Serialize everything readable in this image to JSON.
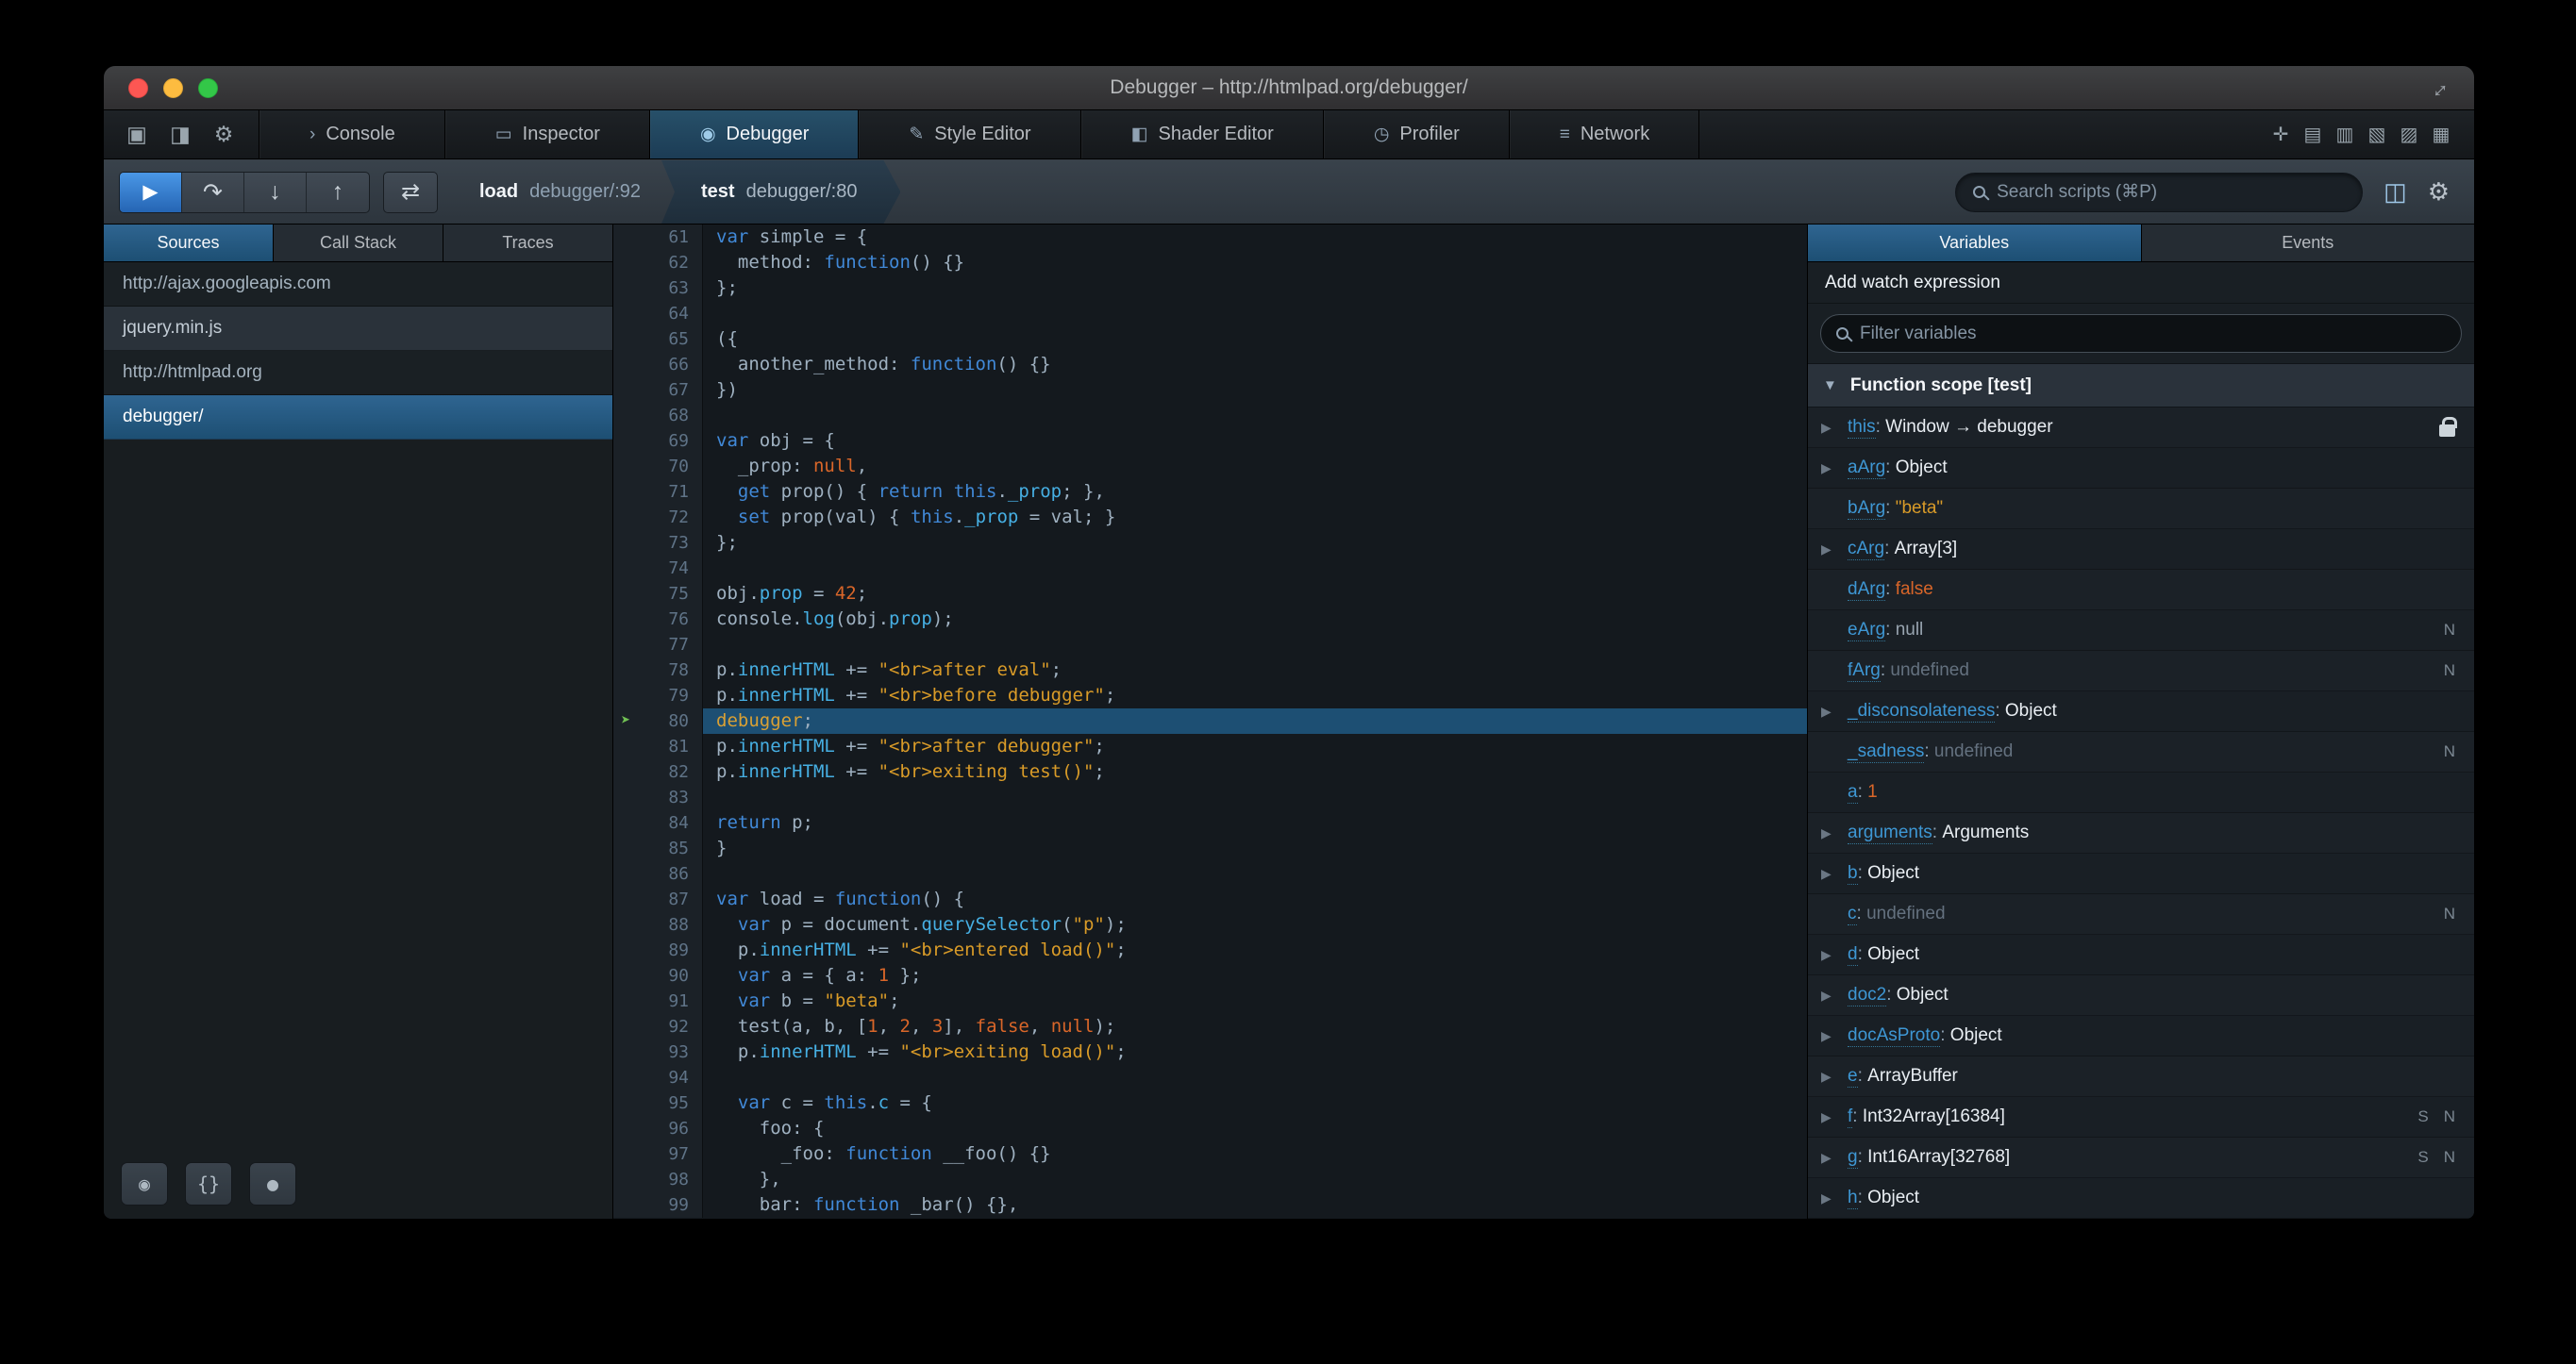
{
  "icons": {
    "dock_bottom": "▣",
    "dock_side": "◨",
    "options_gear": "⚙",
    "console_tab": "›",
    "inspector_tab": "▭",
    "debugger_tab": "◉",
    "style_editor_tab": "✎",
    "shader_editor_tab": "◧",
    "profiler_tab": "◷",
    "network_tab": "≡",
    "pick_element": "✛",
    "split_console": "▤",
    "responsive_design": "▥",
    "paint_flashing": "▧",
    "scratchpad": "▨",
    "app_grid": "▦",
    "resume": "▶",
    "step_over": "↷",
    "step_in": "↓",
    "step_out": "↑",
    "pause_exceptions": "⇄",
    "panel_toggle": "◫",
    "debug_gear": "⚙",
    "eye": "◉",
    "prettyprint": "{}",
    "blackbox": "●",
    "caret_right": "▶",
    "caret_down": "▼",
    "debug_arrow": "➤",
    "fullscreen": "↔"
  },
  "titlebar": {
    "title": "Debugger – http://htmlpad.org/debugger/"
  },
  "tabbar": {
    "left_icons": [
      {
        "id": "dock-bottom",
        "icon": "dock_bottom"
      },
      {
        "id": "dock-side",
        "icon": "dock_side"
      },
      {
        "id": "options-gear",
        "icon": "options_gear"
      }
    ],
    "tabs": [
      {
        "id": "console",
        "label": "Console",
        "icon": "console_tab",
        "active": false
      },
      {
        "id": "inspector",
        "label": "Inspector",
        "icon": "inspector_tab",
        "active": false
      },
      {
        "id": "debugger",
        "label": "Debugger",
        "icon": "debugger_tab",
        "active": true
      },
      {
        "id": "style-editor",
        "label": "Style Editor",
        "icon": "style_editor_tab",
        "active": false
      },
      {
        "id": "shader-editor",
        "label": "Shader Editor",
        "icon": "shader_editor_tab",
        "active": false
      },
      {
        "id": "profiler",
        "label": "Profiler",
        "icon": "profiler_tab",
        "active": false
      },
      {
        "id": "network",
        "label": "Network",
        "icon": "network_tab",
        "active": false
      }
    ],
    "right_icons": [
      {
        "id": "pick-element",
        "icon": "pick_element"
      },
      {
        "id": "split-console",
        "icon": "split_console"
      },
      {
        "id": "responsive-design",
        "icon": "responsive_design"
      },
      {
        "id": "paint-flashing",
        "icon": "paint_flashing"
      },
      {
        "id": "scratchpad",
        "icon": "scratchpad"
      },
      {
        "id": "app-grid",
        "icon": "app_grid"
      }
    ]
  },
  "debugbar": {
    "controls": [
      {
        "id": "resume",
        "icon": "resume",
        "primary": true
      },
      {
        "id": "step-over",
        "icon": "step_over"
      },
      {
        "id": "step-in",
        "icon": "step_in"
      },
      {
        "id": "step-out",
        "icon": "step_out"
      }
    ],
    "breadcrumbs": [
      {
        "fn": "load",
        "loc": "debugger/:92"
      },
      {
        "fn": "test",
        "loc": "debugger/:80"
      }
    ],
    "search_placeholder": "Search scripts (⌘P)"
  },
  "sidebar": {
    "tabs": [
      {
        "id": "sources",
        "label": "Sources",
        "active": true
      },
      {
        "id": "call-stack",
        "label": "Call Stack",
        "active": false
      },
      {
        "id": "traces",
        "label": "Traces",
        "active": false
      }
    ],
    "sources": [
      {
        "id": "ajax-googleapis",
        "label": "http://ajax.googleapis.com",
        "kind": "group",
        "selected": false
      },
      {
        "id": "jquery-min-js",
        "label": "jquery.min.js",
        "kind": "file",
        "selected": false
      },
      {
        "id": "htmlpad-org",
        "label": "http://htmlpad.org",
        "kind": "group",
        "selected": false
      },
      {
        "id": "debugger",
        "label": "debugger/",
        "kind": "file",
        "selected": true
      }
    ],
    "footer_buttons": [
      {
        "id": "toggle-pause-on-event",
        "icon": "eye"
      },
      {
        "id": "prettify-source",
        "icon": "prettyprint"
      },
      {
        "id": "blackbox-source",
        "icon": "blackbox"
      }
    ]
  },
  "editor": {
    "current_line": 80,
    "lines": [
      {
        "n": 61,
        "t": [
          [
            "k",
            "var"
          ],
          [
            "d",
            " simple = {"
          ]
        ]
      },
      {
        "n": 62,
        "t": [
          [
            "d",
            "  method: "
          ],
          [
            "k",
            "function"
          ],
          [
            "d",
            "() {}"
          ]
        ]
      },
      {
        "n": 63,
        "t": [
          [
            "d",
            "};"
          ]
        ]
      },
      {
        "n": 64,
        "t": []
      },
      {
        "n": 65,
        "t": [
          [
            "d",
            "({"
          ]
        ]
      },
      {
        "n": 66,
        "t": [
          [
            "d",
            "  another_method: "
          ],
          [
            "k",
            "function"
          ],
          [
            "d",
            "() {}"
          ]
        ]
      },
      {
        "n": 67,
        "t": [
          [
            "d",
            "})"
          ]
        ]
      },
      {
        "n": 68,
        "t": []
      },
      {
        "n": 69,
        "t": [
          [
            "k",
            "var"
          ],
          [
            "d",
            " obj = {"
          ]
        ]
      },
      {
        "n": 70,
        "t": [
          [
            "d",
            "  _prop: "
          ],
          [
            "a",
            "null"
          ],
          [
            "d",
            ","
          ]
        ]
      },
      {
        "n": 71,
        "t": [
          [
            "d",
            "  "
          ],
          [
            "k",
            "get"
          ],
          [
            "d",
            " prop() { "
          ],
          [
            "k",
            "return"
          ],
          [
            "d",
            " "
          ],
          [
            "k",
            "this"
          ],
          [
            "d",
            "."
          ],
          [
            "p",
            "_prop"
          ],
          [
            "d",
            "; },"
          ]
        ]
      },
      {
        "n": 72,
        "t": [
          [
            "d",
            "  "
          ],
          [
            "k",
            "set"
          ],
          [
            "d",
            " prop(val) { "
          ],
          [
            "k",
            "this"
          ],
          [
            "d",
            "."
          ],
          [
            "p",
            "_prop"
          ],
          [
            "d",
            " = val; }"
          ]
        ]
      },
      {
        "n": 73,
        "t": [
          [
            "d",
            "};"
          ]
        ]
      },
      {
        "n": 74,
        "t": []
      },
      {
        "n": 75,
        "t": [
          [
            "d",
            "obj."
          ],
          [
            "p",
            "prop"
          ],
          [
            "d",
            " = "
          ],
          [
            "n",
            "42"
          ],
          [
            "d",
            ";"
          ]
        ]
      },
      {
        "n": 76,
        "t": [
          [
            "d",
            "console."
          ],
          [
            "p",
            "log"
          ],
          [
            "d",
            "(obj."
          ],
          [
            "p",
            "prop"
          ],
          [
            "d",
            ");"
          ]
        ]
      },
      {
        "n": 77,
        "t": []
      },
      {
        "n": 78,
        "t": [
          [
            "d",
            "p."
          ],
          [
            "p",
            "innerHTML"
          ],
          [
            "d",
            " += "
          ],
          [
            "s",
            "\"<br>after eval\""
          ],
          [
            "d",
            ";"
          ]
        ]
      },
      {
        "n": 79,
        "t": [
          [
            "d",
            "p."
          ],
          [
            "p",
            "innerHTML"
          ],
          [
            "d",
            " += "
          ],
          [
            "s",
            "\"<br>before debugger\""
          ],
          [
            "d",
            ";"
          ]
        ]
      },
      {
        "n": 80,
        "t": [
          [
            "g",
            "debugger"
          ],
          [
            "d",
            ";"
          ]
        ]
      },
      {
        "n": 81,
        "t": [
          [
            "d",
            "p."
          ],
          [
            "p",
            "innerHTML"
          ],
          [
            "d",
            " += "
          ],
          [
            "s",
            "\"<br>after debugger\""
          ],
          [
            "d",
            ";"
          ]
        ]
      },
      {
        "n": 82,
        "t": [
          [
            "d",
            "p."
          ],
          [
            "p",
            "innerHTML"
          ],
          [
            "d",
            " += "
          ],
          [
            "s",
            "\"<br>exiting test()\""
          ],
          [
            "d",
            ";"
          ]
        ]
      },
      {
        "n": 83,
        "t": []
      },
      {
        "n": 84,
        "t": [
          [
            "k",
            "return"
          ],
          [
            "d",
            " p;"
          ]
        ]
      },
      {
        "n": 85,
        "t": [
          [
            "d",
            "}"
          ]
        ]
      },
      {
        "n": 86,
        "t": []
      },
      {
        "n": 87,
        "t": [
          [
            "k",
            "var"
          ],
          [
            "d",
            " load = "
          ],
          [
            "k",
            "function"
          ],
          [
            "d",
            "() {"
          ]
        ]
      },
      {
        "n": 88,
        "t": [
          [
            "d",
            "  "
          ],
          [
            "k",
            "var"
          ],
          [
            "d",
            " p = document."
          ],
          [
            "p",
            "querySelector"
          ],
          [
            "d",
            "("
          ],
          [
            "s",
            "\"p\""
          ],
          [
            "d",
            ");"
          ]
        ]
      },
      {
        "n": 89,
        "t": [
          [
            "d",
            "  p."
          ],
          [
            "p",
            "innerHTML"
          ],
          [
            "d",
            " += "
          ],
          [
            "s",
            "\"<br>entered load()\""
          ],
          [
            "d",
            ";"
          ]
        ]
      },
      {
        "n": 90,
        "t": [
          [
            "d",
            "  "
          ],
          [
            "k",
            "var"
          ],
          [
            "d",
            " a = { a: "
          ],
          [
            "n",
            "1"
          ],
          [
            "d",
            " };"
          ]
        ]
      },
      {
        "n": 91,
        "t": [
          [
            "d",
            "  "
          ],
          [
            "k",
            "var"
          ],
          [
            "d",
            " b = "
          ],
          [
            "s",
            "\"beta\""
          ],
          [
            "d",
            ";"
          ]
        ]
      },
      {
        "n": 92,
        "t": [
          [
            "d",
            "  test(a, b, ["
          ],
          [
            "n",
            "1"
          ],
          [
            "d",
            ", "
          ],
          [
            "n",
            "2"
          ],
          [
            "d",
            ", "
          ],
          [
            "n",
            "3"
          ],
          [
            "d",
            "], "
          ],
          [
            "a",
            "false"
          ],
          [
            "d",
            ", "
          ],
          [
            "a",
            "null"
          ],
          [
            "d",
            ");"
          ]
        ]
      },
      {
        "n": 93,
        "t": [
          [
            "d",
            "  p."
          ],
          [
            "p",
            "innerHTML"
          ],
          [
            "d",
            " += "
          ],
          [
            "s",
            "\"<br>exiting load()\""
          ],
          [
            "d",
            ";"
          ]
        ]
      },
      {
        "n": 94,
        "t": []
      },
      {
        "n": 95,
        "t": [
          [
            "d",
            "  "
          ],
          [
            "k",
            "var"
          ],
          [
            "d",
            " c = "
          ],
          [
            "k",
            "this"
          ],
          [
            "d",
            "."
          ],
          [
            "p",
            "c"
          ],
          [
            "d",
            " = {"
          ]
        ]
      },
      {
        "n": 96,
        "t": [
          [
            "d",
            "    foo: {"
          ]
        ]
      },
      {
        "n": 97,
        "t": [
          [
            "d",
            "      _foo: "
          ],
          [
            "k",
            "function"
          ],
          [
            "d",
            " __foo() {}"
          ]
        ]
      },
      {
        "n": 98,
        "t": [
          [
            "d",
            "    },"
          ]
        ]
      },
      {
        "n": 99,
        "t": [
          [
            "d",
            "    bar: "
          ],
          [
            "k",
            "function"
          ],
          [
            "d",
            " _bar() {},"
          ]
        ]
      }
    ]
  },
  "variables_panel": {
    "tabs": [
      {
        "id": "variables",
        "label": "Variables",
        "active": true
      },
      {
        "id": "events",
        "label": "Events",
        "active": false
      }
    ],
    "watch_label": "Add watch expression",
    "filter_placeholder": "Filter variables",
    "scope_label": "Function scope [test]",
    "variables": [
      {
        "name": "this",
        "value": "Window → debugger",
        "vclass": "obj",
        "exp": true,
        "lock": true
      },
      {
        "name": "aArg",
        "value": "Object",
        "vclass": "obj",
        "exp": true
      },
      {
        "name": "bArg",
        "value": "\"beta\"",
        "vclass": "str"
      },
      {
        "name": "cArg",
        "value": "Array[3]",
        "vclass": "obj",
        "exp": true
      },
      {
        "name": "dArg",
        "value": "false",
        "vclass": "bool"
      },
      {
        "name": "eArg",
        "value": "null",
        "vclass": "null",
        "badges": [
          "N"
        ]
      },
      {
        "name": "fArg",
        "value": "undefined",
        "vclass": "undef",
        "badges": [
          "N"
        ]
      },
      {
        "name": "_disconsolateness",
        "value": "Object",
        "vclass": "obj",
        "exp": true
      },
      {
        "name": "_sadness",
        "value": "undefined",
        "vclass": "undef",
        "badges": [
          "N"
        ]
      },
      {
        "name": "a",
        "value": "1",
        "vclass": "num"
      },
      {
        "name": "arguments",
        "value": "Arguments",
        "vclass": "obj",
        "exp": true
      },
      {
        "name": "b",
        "value": "Object",
        "vclass": "obj",
        "exp": true
      },
      {
        "name": "c",
        "value": "undefined",
        "vclass": "undef",
        "badges": [
          "N"
        ]
      },
      {
        "name": "d",
        "value": "Object",
        "vclass": "obj",
        "exp": true
      },
      {
        "name": "doc2",
        "value": "Object",
        "vclass": "obj",
        "exp": true
      },
      {
        "name": "docAsProto",
        "value": "Object",
        "vclass": "obj",
        "exp": true
      },
      {
        "name": "e",
        "value": "ArrayBuffer",
        "vclass": "obj",
        "exp": true
      },
      {
        "name": "f",
        "value": "Int32Array[16384]",
        "vclass": "obj",
        "exp": true,
        "badges": [
          "S",
          "N"
        ]
      },
      {
        "name": "g",
        "value": "Int16Array[32768]",
        "vclass": "obj",
        "exp": true,
        "badges": [
          "S",
          "N"
        ]
      },
      {
        "name": "h",
        "value": "Object",
        "vclass": "obj",
        "exp": true
      }
    ]
  }
}
